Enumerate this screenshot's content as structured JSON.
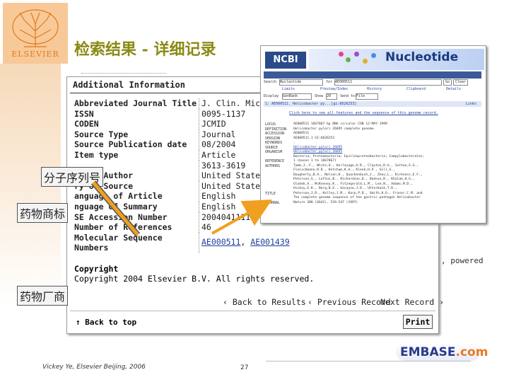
{
  "slide": {
    "title": "检索结果 - 详细记录",
    "logo_text": "ELSEVIER",
    "footer_credit": "Vickey Ye, Elsevier Beijing, 2006",
    "page_number": "27",
    "embase_brand": "EMBASE",
    "embase_suffix": ".com"
  },
  "annotations": {
    "seq_no": "分子序列号",
    "drug_brand": "药物商标",
    "drug_maker": "药物厂商"
  },
  "record": {
    "header": "Additional Information",
    "rows": [
      {
        "label": "Abbreviated Journal Title",
        "value": "J. Clin. Microbio"
      },
      {
        "label": "ISSN",
        "value": "0095-1137"
      },
      {
        "label": "CODEN",
        "value": "JCMID"
      },
      {
        "label": "Source Type",
        "value": "Journal"
      },
      {
        "label": "Source Publication date",
        "value": "08/2004"
      },
      {
        "label": "Item type",
        "value": "Article"
      },
      {
        "label": "",
        "value": "3613-3619"
      },
      {
        "label": "ry of Author",
        "value": "United States"
      },
      {
        "label": "ry of Source",
        "value": "United States"
      },
      {
        "label": "anguage of Article",
        "value": "English"
      },
      {
        "label": "nguage of Summary",
        "value": "English"
      },
      {
        "label": "SE Accession Number",
        "value": "2004041111"
      },
      {
        "label": "Number of References",
        "value": "46"
      },
      {
        "label": "Molecular Sequence",
        "value": ""
      },
      {
        "label": "Numbers",
        "value": ""
      }
    ],
    "seq_links": [
      "AE000511",
      "AE001439"
    ],
    "copyright_header": "Copyright",
    "copyright_text": "Copyright 2004 Elsevier B.V. All rights reserved.",
    "back_to_results": "Back to Results",
    "previous_record": "Previous Record",
    "next_record": "Next Record",
    "back_to_top": "Back to top",
    "print": "Print"
  },
  "ncbi": {
    "logo": "NCBI",
    "db_title": "Nucleotide",
    "search_label": "Search",
    "search_db": "Nucleotide",
    "for_label": "for",
    "search_term": "AE000511",
    "go_btn": "Go",
    "clear_btn": "Clear",
    "tabs": [
      "Limits",
      "Preview/Index",
      "History",
      "Clipboard",
      "Details"
    ],
    "display_label": "Display",
    "display_value": "GenBank",
    "show_label": "Show",
    "show_value": "20",
    "send_label": "Send to",
    "send_value": "File",
    "accession_line": "1: AE000511. Helicobacter py...[gi:6626253]",
    "links_label": "Links",
    "notice": "Click here to see all features and the sequence of this genome record.",
    "side_labels": [
      "LOCUS",
      "DEFINITION",
      "ACCESSION",
      "VERSION",
      "KEYWORDS",
      "SOURCE",
      "ORGANISM",
      "",
      "REFERENCE",
      "AUTHORS",
      "",
      "",
      "",
      "",
      "",
      "TITLE",
      "",
      "JOURNAL"
    ],
    "record_lines": [
      "AE000511    1667867 bp    DNA    circular  CON 12-MAY-1999",
      "Helicobacter pylori 26695 complete genome.",
      "AE000511",
      "AE000511.1  GI:6626253",
      ".",
      "Helicobacter pylori 26695",
      "Helicobacter pylori 26695",
      "Bacteria; Proteobacteria; Epsilonproteobacteria; Campylobacterales;",
      "1  (bases 1 to 1667867)",
      "Tomb,J.-F., White,O., Kerlavage,A.R., Clayton,R.A., Sutton,G.G.,",
      "Fleischmann,R.D., Ketchum,K.A., Klenk,H.P., Gill,S.,",
      "Dougherty,B.A., Nelson,K., Quackenbush,J., Zhou,L., Kirkness,E.F.,",
      "Peterson,S., Loftus,B., Richardson,D., Dodson,R., Khalak,H.G.,",
      "Glodek,A., McKenney,K., Fitzegerald,L.M., Lee,N., Adams,M.D.,",
      "Hickey,E.K., Berg,D.E., Gocayne,J.D., Utterback,T.R.,",
      "Peterson,J.D., Kelley,J.M., Karp,P.D., Smith,H.O., Fraser,C.M. and",
      "The complete genome sequence of the gastric pathogen Helicobacter",
      "Nature 388 (6642), 539-547 (1997)"
    ]
  },
  "powered_text": ", powered"
}
